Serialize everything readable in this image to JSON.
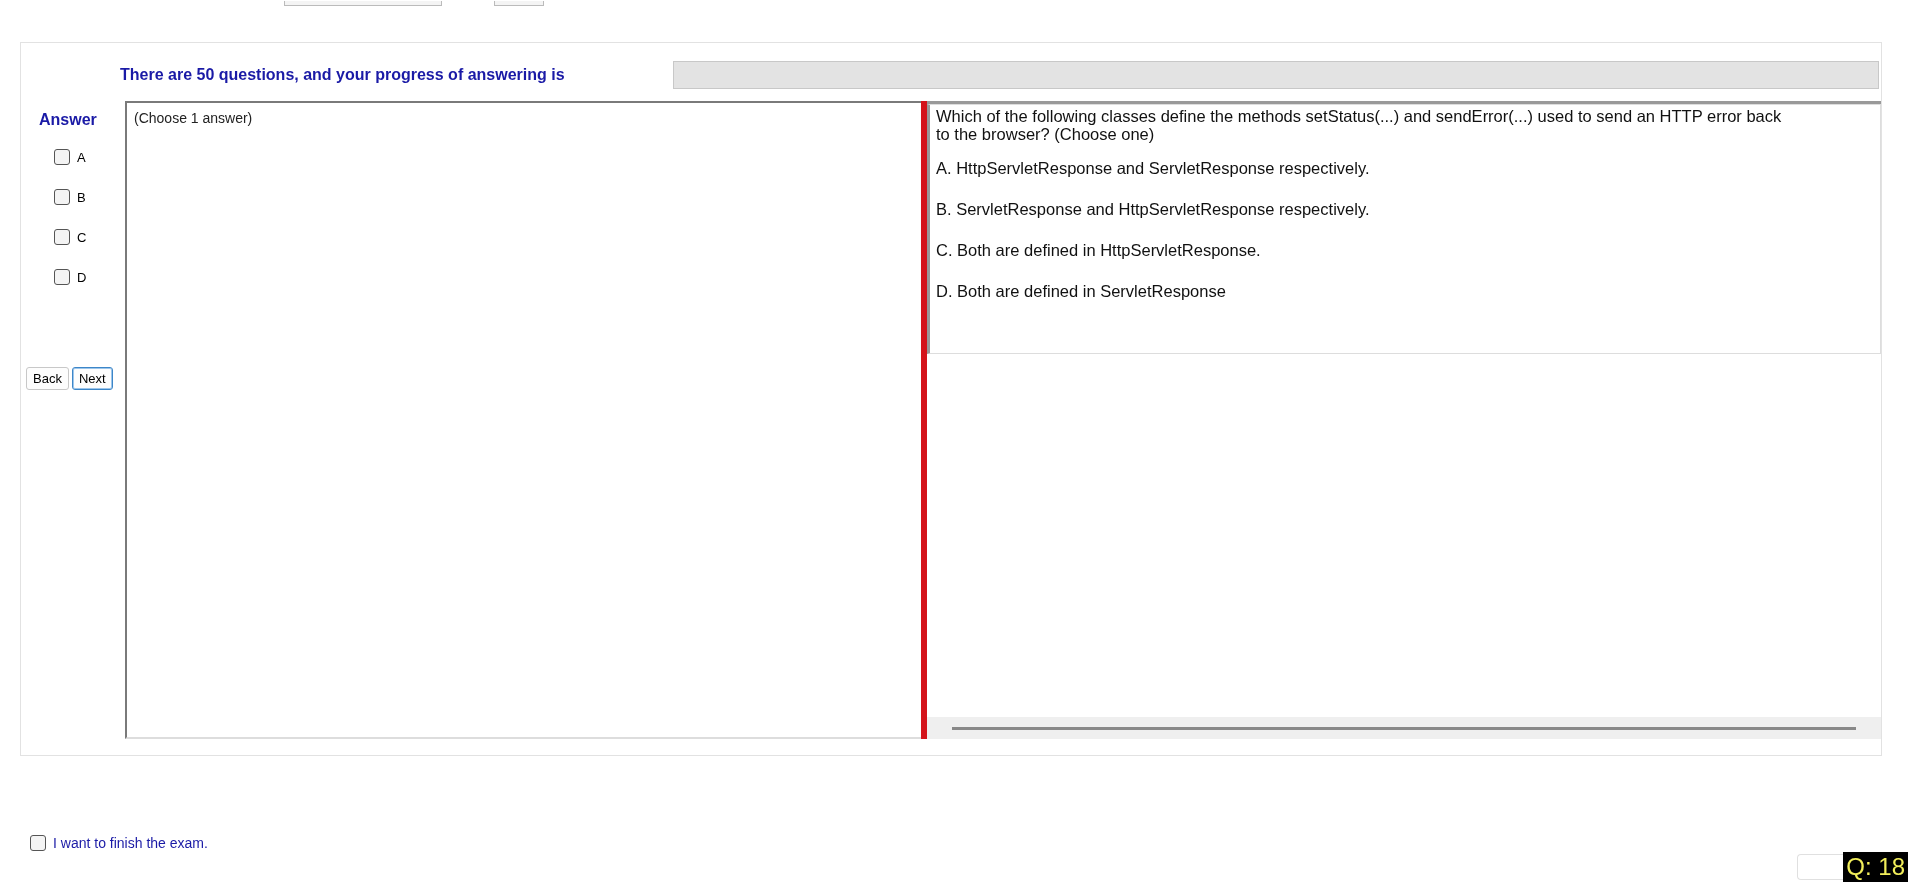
{
  "progress": {
    "label": "There are 50 questions, and your progress of answering is",
    "level": 0
  },
  "answer": {
    "title": "Answer",
    "options": [
      {
        "label": "A",
        "checked": false
      },
      {
        "label": "B",
        "checked": false
      },
      {
        "label": "C",
        "checked": false
      },
      {
        "label": "D",
        "checked": false
      }
    ]
  },
  "buttons": [
    {
      "label": "Back",
      "selected": false
    },
    {
      "label": "Next",
      "selected": true
    }
  ],
  "instruction": "(Choose 1 answer)",
  "question": {
    "text": "Which of the following classes define the methods setStatus(...) and sendError(...) used to send an HTTP error back to the browser? (Choose one)",
    "choices": [
      "A.  HttpServletResponse and ServletResponse respectively.",
      "B.  ServletResponse and HttpServletResponse respectively.",
      "C.  Both are defined in HttpServletResponse.",
      "D.  Both are defined in ServletResponse"
    ]
  },
  "finish": {
    "label": "I want to finish the exam.",
    "checked": false
  },
  "question_badge": "Q: 18"
}
